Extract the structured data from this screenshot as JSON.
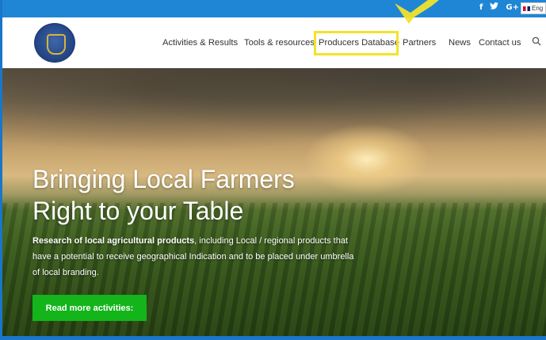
{
  "topbar": {
    "social": [
      "f",
      "✦",
      "G+"
    ],
    "language": "Eng"
  },
  "nav": {
    "items": [
      {
        "label": "Activities & Results"
      },
      {
        "label": "Tools & resources"
      },
      {
        "label": "Producers Database"
      },
      {
        "label": "Partners"
      },
      {
        "label": "News"
      },
      {
        "label": "Contact us"
      }
    ],
    "highlighted_item": "Producers Database",
    "highlight_color": "#f1e32a"
  },
  "hero": {
    "title_line1": "Bringing Local Farmers",
    "title_line2": "Right to your Table",
    "desc_bold": "Research of local agricultural products",
    "desc_rest": ", including Local / regional products that have a potential to receive geographical Indication and to be placed under umbrella of local branding.",
    "cta_label": "Read more activities:",
    "cta_color": "#13b51b"
  },
  "colors": {
    "topbar": "#1f86d6",
    "frame": "#1976c9"
  }
}
